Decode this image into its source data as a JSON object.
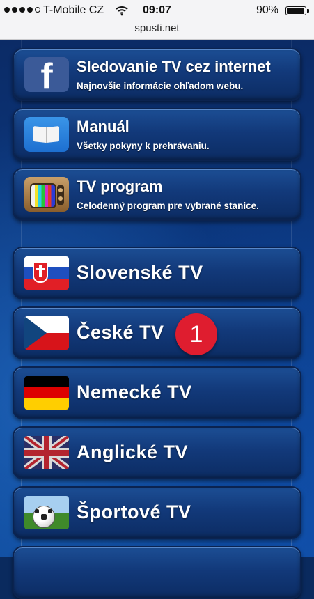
{
  "status_bar": {
    "carrier": "T-Mobile CZ",
    "time": "09:07",
    "battery": "90%",
    "url": "spusti.net"
  },
  "menu_top": [
    {
      "title": "Sledovanie TV cez internet",
      "subtitle": "Najnovšie informácie ohľadom webu.",
      "icon": "facebook-icon"
    },
    {
      "title": "Manuál",
      "subtitle": "Všetky pokyny k prehrávaniu.",
      "icon": "book-icon"
    },
    {
      "title": "TV program",
      "subtitle": "Celodenný program pre vybrané stanice.",
      "icon": "tv-icon"
    }
  ],
  "menu_channels": [
    {
      "title": "Slovenské TV",
      "icon": "slovak-flag-icon"
    },
    {
      "title": "České TV",
      "icon": "czech-flag-icon"
    },
    {
      "title": "Nemecké TV",
      "icon": "german-flag-icon"
    },
    {
      "title": "Anglické TV",
      "icon": "uk-flag-icon"
    },
    {
      "title": "Športové TV",
      "icon": "soccer-ball-icon"
    }
  ],
  "badge": "1",
  "colors": {
    "tile": "#12397a",
    "badge": "#df1d2f",
    "background": "#0b3a85"
  }
}
